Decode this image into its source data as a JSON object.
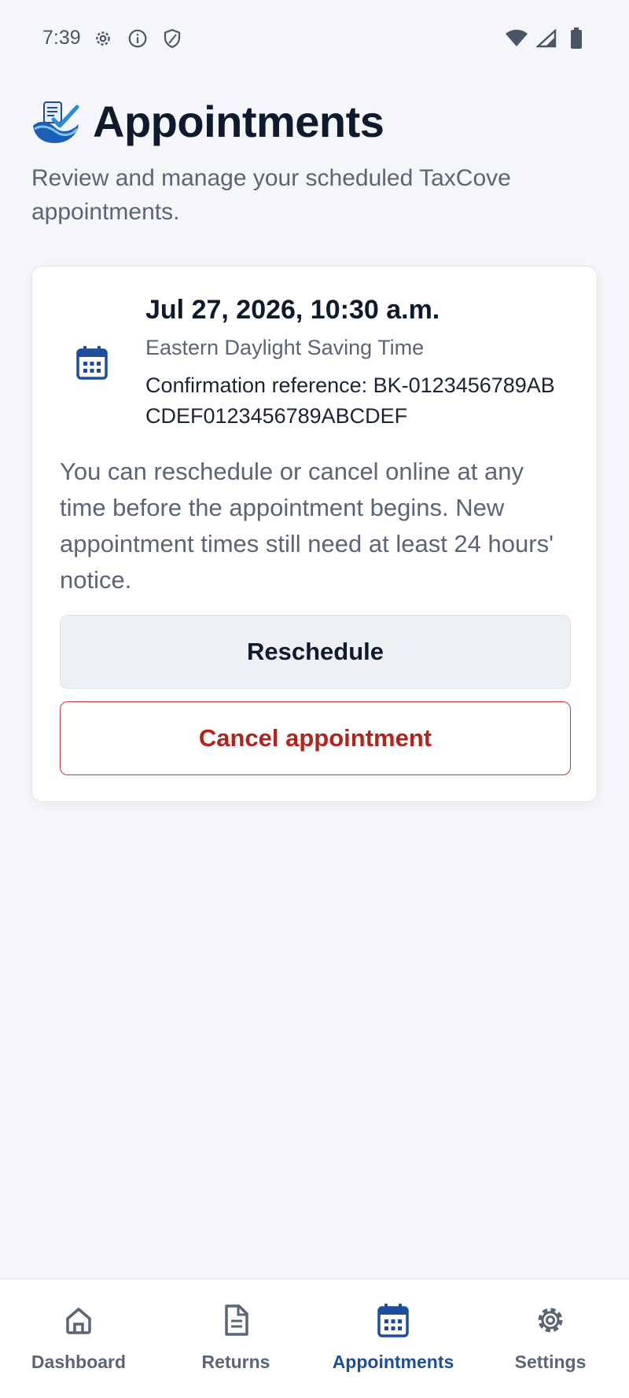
{
  "status_bar": {
    "time": "7:39",
    "left_icons": [
      "gear-icon",
      "info-icon",
      "shield-icon"
    ],
    "right_icons": [
      "wifi-icon",
      "signal-icon",
      "battery-icon"
    ]
  },
  "header": {
    "logo_icon": "taxcove-logo-icon",
    "title": "Appointments",
    "subtitle": "Review and manage your scheduled TaxCove appointments."
  },
  "appointment": {
    "icon": "calendar-icon",
    "date_time": "Jul 27, 2026, 10:30 a.m.",
    "timezone": "Eastern Daylight Saving Time",
    "confirmation": "Confirmation reference: BK-0123456789ABCDEF0123456789ABCDEF",
    "note": "You can reschedule or cancel online at any time before the appointment begins. New appointment times still need at least 24 hours' notice.",
    "reschedule_label": "Reschedule",
    "cancel_label": "Cancel appointment"
  },
  "bottom_nav": {
    "items": [
      {
        "label": "Dashboard",
        "icon": "home-icon",
        "active": false
      },
      {
        "label": "Returns",
        "icon": "document-icon",
        "active": false
      },
      {
        "label": "Appointments",
        "icon": "calendar-icon",
        "active": true
      },
      {
        "label": "Settings",
        "icon": "gear-icon",
        "active": false
      }
    ]
  },
  "colors": {
    "accent": "#1d4e9e",
    "danger": "#b4231b",
    "background": "#f4f6f9",
    "text_primary": "#0f1a2e",
    "text_secondary": "#5a6577"
  }
}
